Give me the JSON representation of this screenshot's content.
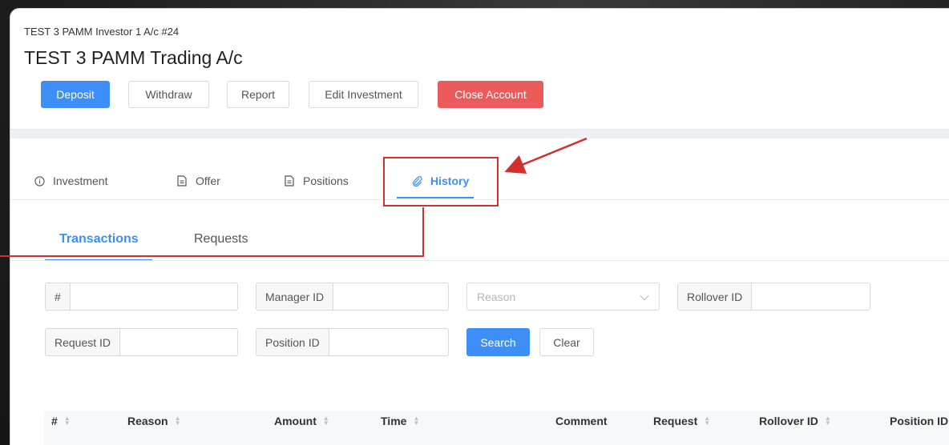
{
  "account": {
    "subtitle": "TEST 3 PAMM Investor 1 A/c #24",
    "title": "TEST 3 PAMM Trading A/c"
  },
  "actions": {
    "deposit": "Deposit",
    "withdraw": "Withdraw",
    "report": "Report",
    "edit_investment": "Edit Investment",
    "close_account": "Close Account"
  },
  "main_tabs": {
    "investment": "Investment",
    "offer": "Offer",
    "positions": "Positions",
    "history": "History",
    "active": "History"
  },
  "sub_tabs": {
    "transactions": "Transactions",
    "requests": "Requests",
    "active": "Transactions"
  },
  "filters": {
    "number_label": "#",
    "manager_id_label": "Manager ID",
    "reason_placeholder": "Reason",
    "rollover_id_label": "Rollover ID",
    "request_id_label": "Request ID",
    "position_id_label": "Position ID",
    "search": "Search",
    "clear": "Clear"
  },
  "table": {
    "columns": [
      "#",
      "Reason",
      "Amount",
      "Time",
      "Comment",
      "Request",
      "Rollover ID",
      "Position ID"
    ]
  },
  "colors": {
    "primary": "#3d8ff7",
    "danger": "#ec5b5b",
    "annotation": "#d42f2f"
  },
  "icons": {
    "investment": "info-circle-icon",
    "offer": "document-icon",
    "positions": "document-icon",
    "history": "paperclip-icon",
    "reason_select": "chevron-down-icon",
    "sort": "sort-icon"
  }
}
